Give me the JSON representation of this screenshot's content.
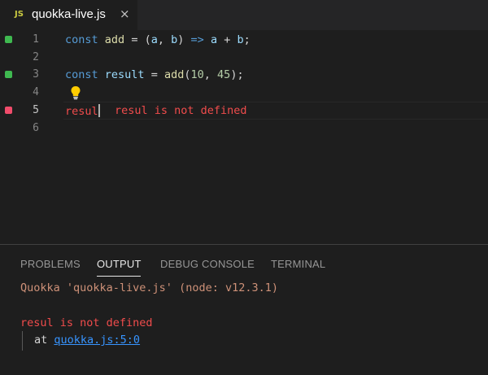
{
  "tab": {
    "icon": "JS",
    "label": "quokka-live.js",
    "close": "×"
  },
  "editor": {
    "lines": [
      {
        "num": "1",
        "marker": "#3fb950",
        "code": "const add = (a, b) => a + b;"
      },
      {
        "num": "2",
        "marker": null,
        "code": ""
      },
      {
        "num": "3",
        "marker": "#3fb950",
        "code": "const result = add(10, 45);"
      },
      {
        "num": "4",
        "marker": null,
        "code": ""
      },
      {
        "num": "5",
        "marker": "#f14c6b",
        "code": "resul"
      },
      {
        "num": "6",
        "marker": null,
        "code": ""
      }
    ],
    "inline_error": "resul is not defined",
    "lightbulb_icon": "lightbulb-icon"
  },
  "panel": {
    "tabs": [
      "PROBLEMS",
      "OUTPUT",
      "DEBUG CONSOLE",
      "TERMINAL"
    ],
    "active_tab": "OUTPUT",
    "output_title": "Quokka 'quokka-live.js' (node: v12.3.1)",
    "error_message": "resul is not defined",
    "stack_prefix": "at ",
    "stack_link": "quokka.js:5:0"
  },
  "colors": {
    "green_marker": "#3fb950",
    "red_marker": "#f14c6b",
    "error": "#f14c4c",
    "link": "#3794ff"
  }
}
